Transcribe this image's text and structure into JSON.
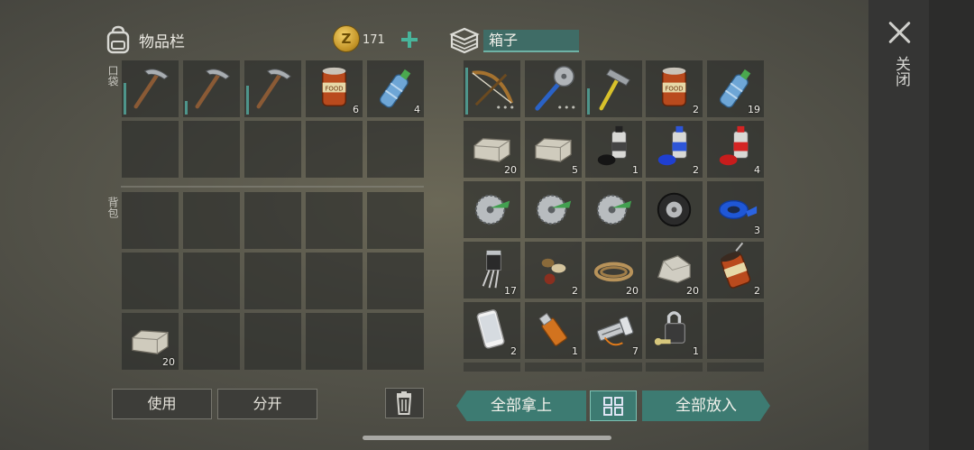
{
  "inventory": {
    "title": "物品栏",
    "coins": "171",
    "coin_symbol": "Z",
    "pocket_label": "口袋",
    "backpack_label": "背包",
    "pocket_slots": [
      {
        "item": "pickaxe-icon",
        "durability": 0.6,
        "qty": ""
      },
      {
        "item": "pickaxe-icon",
        "durability": 0.25,
        "qty": ""
      },
      {
        "item": "pickaxe-icon",
        "durability": 0.55,
        "qty": ""
      },
      {
        "item": "canned-food-icon",
        "qty": "6"
      },
      {
        "item": "water-bottle-icon",
        "qty": "4"
      },
      {
        "item": "",
        "qty": ""
      },
      {
        "item": "",
        "qty": ""
      },
      {
        "item": "",
        "qty": ""
      },
      {
        "item": "",
        "qty": ""
      },
      {
        "item": "",
        "qty": ""
      }
    ],
    "backpack_slots": [
      {
        "item": "",
        "qty": ""
      },
      {
        "item": "",
        "qty": ""
      },
      {
        "item": "",
        "qty": ""
      },
      {
        "item": "",
        "qty": ""
      },
      {
        "item": "",
        "qty": ""
      },
      {
        "item": "",
        "qty": ""
      },
      {
        "item": "",
        "qty": ""
      },
      {
        "item": "",
        "qty": ""
      },
      {
        "item": "",
        "qty": ""
      },
      {
        "item": "",
        "qty": ""
      },
      {
        "item": "stone-block-icon",
        "qty": "20"
      },
      {
        "item": "",
        "qty": ""
      },
      {
        "item": "",
        "qty": ""
      },
      {
        "item": "",
        "qty": ""
      },
      {
        "item": "",
        "qty": ""
      }
    ],
    "use_label": "使用",
    "split_label": "分开"
  },
  "box": {
    "name": "箱子",
    "slots": [
      {
        "item": "crossbow-icon",
        "durability": 0.9,
        "more": true,
        "qty": ""
      },
      {
        "item": "saw-spear-icon",
        "more": true,
        "qty": ""
      },
      {
        "item": "hammer-icon",
        "durability": 0.5,
        "qty": ""
      },
      {
        "item": "canned-food-icon",
        "qty": "2"
      },
      {
        "item": "water-bottle-icon",
        "qty": "19"
      },
      {
        "item": "stone-block-icon",
        "qty": "20"
      },
      {
        "item": "stone-block-icon",
        "qty": "5"
      },
      {
        "item": "spray-paint-black-icon",
        "qty": "1"
      },
      {
        "item": "spray-paint-blue-icon",
        "qty": "2"
      },
      {
        "item": "spray-paint-red-icon",
        "qty": "4"
      },
      {
        "item": "saw-blade-icon",
        "qty": ""
      },
      {
        "item": "saw-blade-icon",
        "qty": ""
      },
      {
        "item": "saw-blade-icon",
        "qty": ""
      },
      {
        "item": "tire-icon",
        "qty": ""
      },
      {
        "item": "duct-tape-icon",
        "qty": "3"
      },
      {
        "item": "transistor-icon",
        "qty": "17"
      },
      {
        "item": "seeds-icon",
        "qty": "2"
      },
      {
        "item": "rope-icon",
        "qty": "20"
      },
      {
        "item": "stone-icon",
        "qty": "20"
      },
      {
        "item": "open-can-icon",
        "qty": "2"
      },
      {
        "item": "smartphone-icon",
        "qty": "2"
      },
      {
        "item": "usb-drive-icon",
        "qty": "1"
      },
      {
        "item": "flashlight-icon",
        "qty": "7"
      },
      {
        "item": "padlock-icon",
        "qty": "1"
      },
      {
        "item": "",
        "qty": ""
      }
    ],
    "take_all_label": "全部拿上",
    "put_all_label": "全部放入"
  },
  "close_label": "关闭",
  "colors": {
    "accent": "#3d7b72",
    "accent_light": "#48b49b",
    "slot_bg": "#2a2c2a"
  }
}
